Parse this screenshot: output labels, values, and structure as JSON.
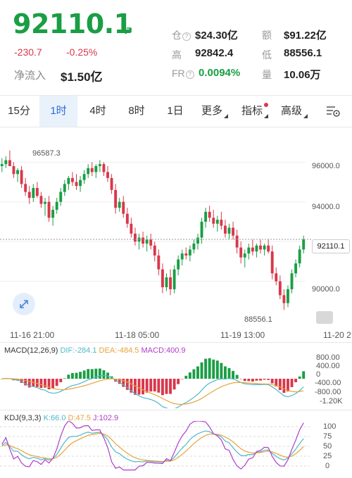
{
  "quote": {
    "price": "92110.1",
    "change": "-230.7",
    "change_pct": "-0.25%",
    "net_inflow_label": "净流入",
    "net_inflow_value": "$1.50亿",
    "stats": {
      "position_label": "仓",
      "position_value": "$24.30亿",
      "amount_label": "额",
      "amount_value": "$91.22亿",
      "high_label": "高",
      "high_value": "92842.4",
      "low_label": "低",
      "low_value": "88556.1",
      "fr_label": "FR",
      "fr_value": "0.0094%",
      "volume_label": "量",
      "volume_value": "10.06万"
    }
  },
  "tabs": [
    {
      "label": "15分"
    },
    {
      "label": "1时"
    },
    {
      "label": "4时"
    },
    {
      "label": "8时"
    },
    {
      "label": "1日"
    },
    {
      "label": "更多"
    },
    {
      "label": "指标"
    },
    {
      "label": "高级"
    }
  ],
  "colors": {
    "up": "#1a9e45",
    "down": "#d9374b",
    "active_tab": "#2a6fd6",
    "dif": "#4fb8c9",
    "dea": "#e8a33a",
    "macd": "#b03cc8",
    "kdj_k": "#4fb8c9",
    "kdj_d": "#e8a33a",
    "kdj_j": "#b03cc8"
  },
  "icons": {
    "settings": "chart-settings-icon",
    "zoom": "expand-icon",
    "trend": "arrow-up-right-icon"
  },
  "chart_data": [
    {
      "type": "candlestick",
      "y_ticks": [
        "96000.0",
        "94000.0",
        "90000.0"
      ],
      "x_ticks": [
        "11-16 21:00",
        "11-18 05:00",
        "11-19 13:00",
        "11-20 2"
      ],
      "ylim": [
        88000,
        97500
      ],
      "last_price_label": "92110.1",
      "annotations": {
        "high": "96587.3",
        "low": "88556.1"
      },
      "last_price": 92110.1,
      "candles": [
        [
          95800,
          96200,
          95500,
          95900
        ],
        [
          95900,
          96300,
          95700,
          96100
        ],
        [
          96100,
          96587.3,
          95900,
          95800
        ],
        [
          95800,
          96000,
          95200,
          95400
        ],
        [
          95400,
          95700,
          95000,
          95600
        ],
        [
          95600,
          95800,
          94700,
          94900
        ],
        [
          94900,
          95200,
          94300,
          94500
        ],
        [
          94500,
          94800,
          93900,
          94200
        ],
        [
          94200,
          94900,
          94000,
          94700
        ],
        [
          94700,
          95000,
          94200,
          94300
        ],
        [
          94300,
          94500,
          93700,
          93900
        ],
        [
          93900,
          94200,
          93300,
          94000
        ],
        [
          94000,
          94300,
          93000,
          93200
        ],
        [
          93200,
          93800,
          92800,
          93600
        ],
        [
          93600,
          94200,
          93400,
          94000
        ],
        [
          94000,
          94700,
          93800,
          94500
        ],
        [
          94500,
          95100,
          94300,
          94900
        ],
        [
          94900,
          95300,
          94600,
          95200
        ],
        [
          95200,
          95500,
          94800,
          95000
        ],
        [
          95000,
          95400,
          94600,
          94800
        ],
        [
          94800,
          95300,
          94500,
          95100
        ],
        [
          95100,
          95600,
          94900,
          95400
        ],
        [
          95400,
          95900,
          95200,
          95700
        ],
        [
          95700,
          96000,
          95300,
          95500
        ],
        [
          95500,
          95900,
          95200,
          95800
        ],
        [
          95800,
          96100,
          95500,
          95900
        ],
        [
          95900,
          96000,
          95300,
          95500
        ],
        [
          95500,
          95800,
          95000,
          95200
        ],
        [
          95200,
          95400,
          94400,
          94600
        ],
        [
          94600,
          94900,
          93400,
          93700
        ],
        [
          93700,
          94200,
          93500,
          94000
        ],
        [
          94000,
          94300,
          93200,
          93400
        ],
        [
          93400,
          93700,
          92700,
          92900
        ],
        [
          92900,
          93200,
          92200,
          92400
        ],
        [
          92400,
          92700,
          91800,
          92000
        ],
        [
          92000,
          92400,
          91600,
          92200
        ],
        [
          92200,
          92500,
          91700,
          91900
        ],
        [
          91900,
          92300,
          91500,
          92100
        ],
        [
          92100,
          92400,
          91600,
          91800
        ],
        [
          91800,
          92000,
          91000,
          91300
        ],
        [
          91300,
          91600,
          90300,
          90600
        ],
        [
          90600,
          90900,
          89400,
          89700
        ],
        [
          89700,
          90400,
          89500,
          90200
        ],
        [
          90200,
          90600,
          89300,
          89600
        ],
        [
          89600,
          90800,
          89400,
          90600
        ],
        [
          90600,
          91300,
          90300,
          91100
        ],
        [
          91100,
          91600,
          90800,
          91400
        ],
        [
          91400,
          91700,
          91100,
          91300
        ],
        [
          91300,
          91800,
          91000,
          91600
        ],
        [
          91600,
          92100,
          91400,
          91900
        ],
        [
          91900,
          92400,
          91600,
          92200
        ],
        [
          92200,
          93200,
          91900,
          93000
        ],
        [
          93000,
          93700,
          92700,
          93500
        ],
        [
          93500,
          93800,
          93000,
          93200
        ],
        [
          93200,
          93600,
          92700,
          92900
        ],
        [
          92900,
          93300,
          92500,
          93100
        ],
        [
          93100,
          93500,
          92600,
          92800
        ],
        [
          92800,
          93100,
          92200,
          92400
        ],
        [
          92400,
          92900,
          92100,
          92700
        ],
        [
          92700,
          93000,
          92100,
          92300
        ],
        [
          92300,
          92600,
          91400,
          91700
        ],
        [
          91700,
          92000,
          90900,
          91200
        ],
        [
          91200,
          91600,
          90700,
          91400
        ],
        [
          91400,
          91900,
          91100,
          91700
        ],
        [
          91700,
          92100,
          91300,
          91500
        ],
        [
          91500,
          91900,
          91200,
          91800
        ],
        [
          91800,
          92100,
          91400,
          91600
        ],
        [
          91600,
          91900,
          91300,
          91800
        ],
        [
          91800,
          92100,
          91400,
          91500
        ],
        [
          91500,
          91800,
          90100,
          90400
        ],
        [
          90400,
          90700,
          89800,
          90000
        ],
        [
          90000,
          90300,
          89100,
          89300
        ],
        [
          89300,
          89600,
          88556.1,
          88900
        ],
        [
          88900,
          89800,
          88700,
          89600
        ],
        [
          89600,
          90600,
          89400,
          90400
        ],
        [
          90400,
          91100,
          90200,
          90900
        ],
        [
          90900,
          91800,
          90700,
          91600
        ],
        [
          91600,
          92300,
          91400,
          92110.1
        ]
      ]
    },
    {
      "type": "line",
      "title": "MACD(12,26,9)",
      "series": [
        {
          "name": "DIF",
          "label_value": "-284.1"
        },
        {
          "name": "DEA",
          "label_value": "-484.5"
        },
        {
          "name": "MACD",
          "label_value": "400.9"
        }
      ],
      "y_ticks": [
        "800.00",
        "400.00",
        "0",
        "-400.00",
        "-800.00",
        "-1.20K"
      ]
    },
    {
      "type": "line",
      "title": "KDJ(9,3,3)",
      "series": [
        {
          "name": "K",
          "label_value": "66.0"
        },
        {
          "name": "D",
          "label_value": "47.5"
        },
        {
          "name": "J",
          "label_value": "102.9"
        }
      ],
      "y_ticks": [
        "100",
        "75",
        "50",
        "25",
        "0"
      ]
    }
  ]
}
